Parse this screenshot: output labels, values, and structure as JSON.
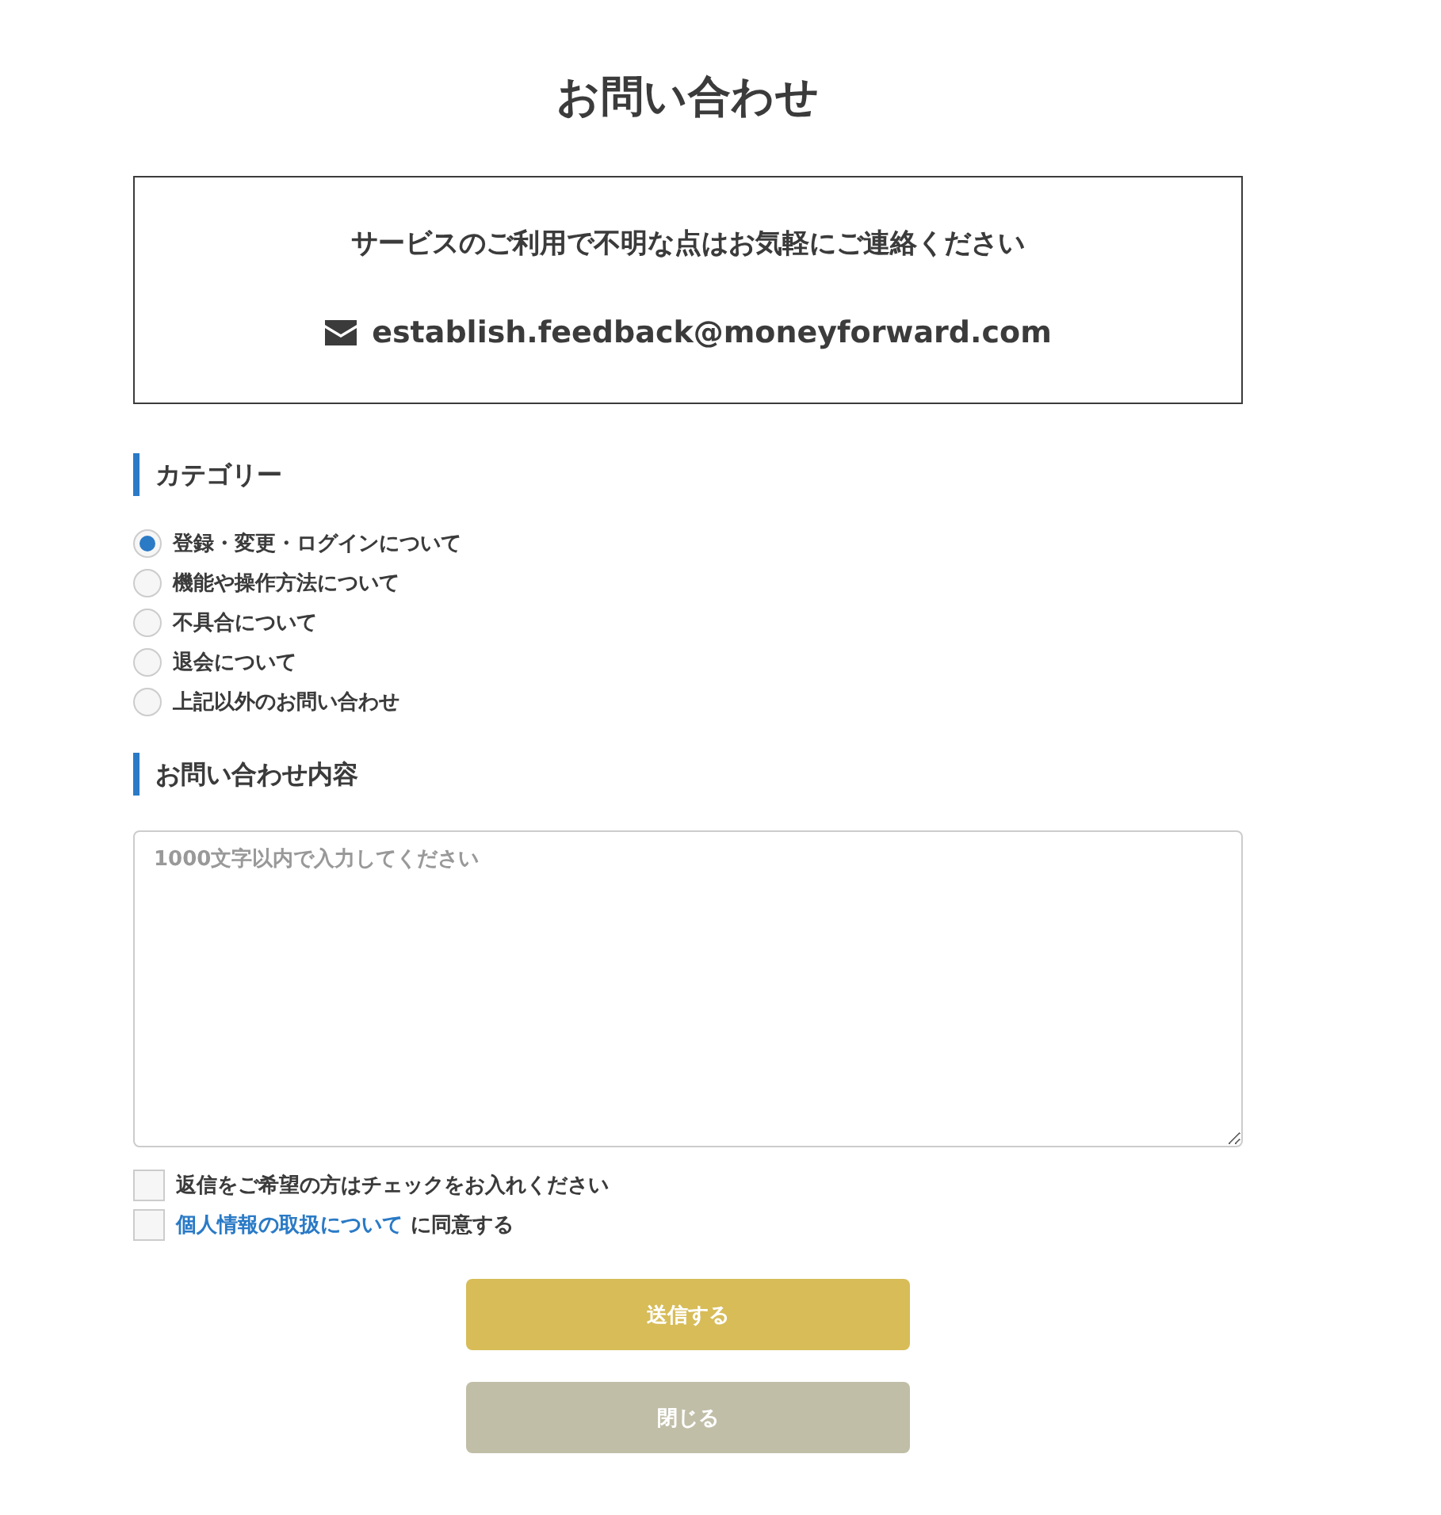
{
  "title": "お問い合わせ",
  "notice": {
    "message": "サービスのご利用で不明な点はお気軽にご連絡ください",
    "email": "establish.feedback@moneyforward.com"
  },
  "category": {
    "heading": "カテゴリー",
    "options": [
      {
        "label": "登録・変更・ログインについて",
        "selected": true
      },
      {
        "label": "機能や操作方法について",
        "selected": false
      },
      {
        "label": "不具合について",
        "selected": false
      },
      {
        "label": "退会について",
        "selected": false
      },
      {
        "label": "上記以外のお問い合わせ",
        "selected": false
      }
    ]
  },
  "content": {
    "heading": "お問い合わせ内容",
    "placeholder": "1000文字以内で入力してください"
  },
  "checkboxes": [
    {
      "kind": "plain",
      "label": "返信をご希望の方はチェックをお入れください",
      "checked": false
    },
    {
      "kind": "link",
      "link": "個人情報の取扱について",
      "label": "に同意する",
      "checked": false
    }
  ],
  "buttons": [
    {
      "kind": "primary",
      "label": "送信する"
    },
    {
      "kind": "secondary",
      "label": "閉じる"
    }
  ]
}
